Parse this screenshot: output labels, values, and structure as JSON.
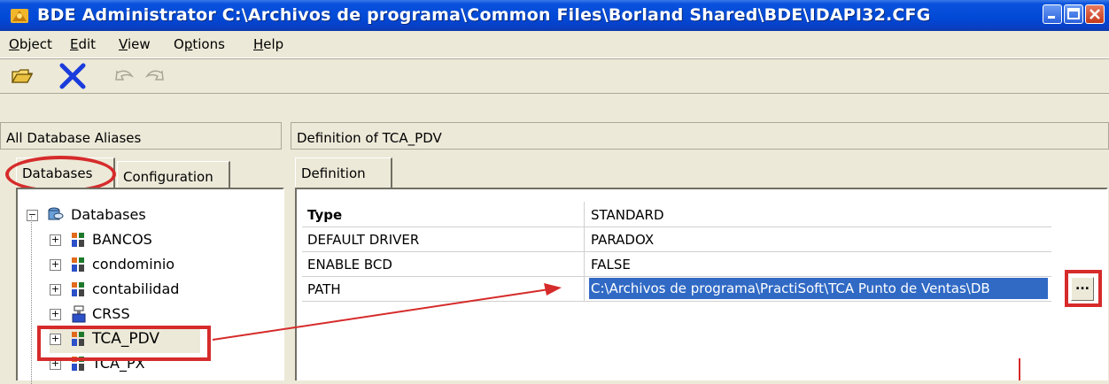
{
  "window": {
    "title": "BDE Administrator  C:\\Archivos de programa\\Common Files\\Borland Shared\\BDE\\IDAPI32.CFG"
  },
  "menu": {
    "items": [
      {
        "label": "Object",
        "accel": "O",
        "rest": "bject"
      },
      {
        "label": "Edit",
        "accel": "E",
        "rest": "dit"
      },
      {
        "label": "View",
        "accel": "V",
        "rest": "iew"
      },
      {
        "label": "Options",
        "accel": "p",
        "pre": "O",
        "rest": "tions"
      },
      {
        "label": "Help",
        "accel": "H",
        "rest": "elp"
      }
    ]
  },
  "toolbar": {
    "icons": [
      "open-folder-icon",
      "delete-x-icon",
      "undo-icon",
      "redo-icon"
    ]
  },
  "left_panel": {
    "header": "All Database Aliases",
    "tabs": [
      "Databases",
      "Configuration"
    ],
    "active_tab": "Databases",
    "tree": {
      "root": "Databases",
      "items": [
        "BANCOS",
        "condominio",
        "contabilidad",
        "CRSS",
        "TCA_PDV",
        "TCA_PX"
      ],
      "selected": "TCA_PDV"
    }
  },
  "right_panel": {
    "header": "Definition of TCA_PDV",
    "tabs": [
      "Definition"
    ],
    "rows": [
      {
        "key": "Type",
        "value": "STANDARD",
        "bold": true
      },
      {
        "key": "DEFAULT DRIVER",
        "value": "PARADOX"
      },
      {
        "key": "ENABLE BCD",
        "value": "FALSE"
      },
      {
        "key": "PATH",
        "value": "C:\\Archivos de programa\\PractiSoft\\TCA Punto de Ventas\\DB"
      }
    ],
    "browse_button": "..."
  },
  "colors": {
    "highlight": "#d62b2b",
    "selection": "#316ac5",
    "titlebar": "#0049d6"
  }
}
